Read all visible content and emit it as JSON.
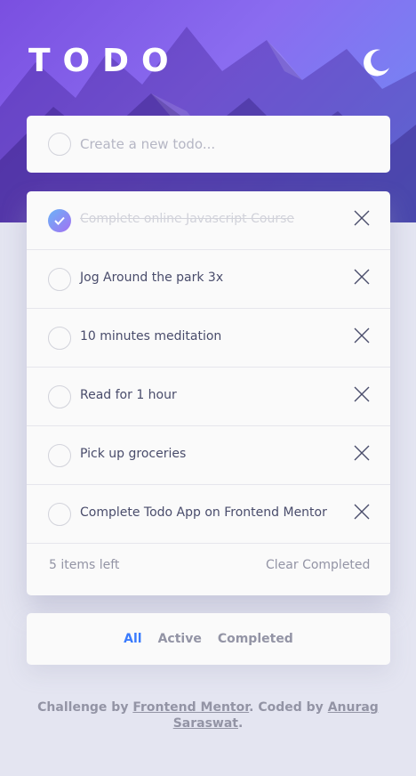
{
  "app": {
    "title": "TODO",
    "theme_icon": "moon-icon"
  },
  "new_todo": {
    "placeholder": "Create a new todo..."
  },
  "todos": [
    {
      "text": "Complete online Javascript Course",
      "completed": true
    },
    {
      "text": "Jog Around the park 3x",
      "completed": false
    },
    {
      "text": "10 minutes meditation",
      "completed": false
    },
    {
      "text": "Read for 1 hour",
      "completed": false
    },
    {
      "text": "Pick up groceries",
      "completed": false
    },
    {
      "text": "Complete Todo App on Frontend Mentor",
      "completed": false
    }
  ],
  "footer": {
    "items_left": "5 items left",
    "clear_label": "Clear Completed"
  },
  "filters": {
    "all": "All",
    "active": "Active",
    "completed": "Completed",
    "selected": "all"
  },
  "attribution": {
    "prefix": "Challenge by ",
    "link1": "Frontend Mentor",
    "middle": ". Coded by ",
    "link2": "Anurag Saraswat",
    "suffix": "."
  },
  "colors": {
    "accent": "#3a7bfd",
    "check_gradient_start": "#6ab3f7",
    "check_gradient_end": "#a371f2"
  }
}
